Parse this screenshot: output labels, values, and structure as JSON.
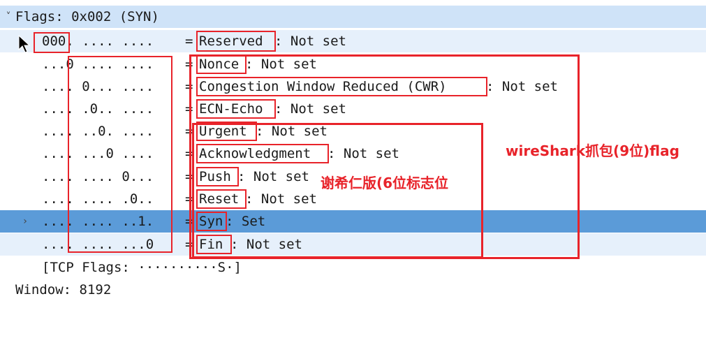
{
  "tree": {
    "flags_header": "Flags: 0x002 (SYN)",
    "rows": [
      {
        "bits": "000. .... ....",
        "name": "Reserved",
        "value": ": Not set"
      },
      {
        "bits": "...0 .... ....",
        "name": "Nonce",
        "value": ": Not set"
      },
      {
        "bits": ".... 0... ....",
        "name": "Congestion Window Reduced (CWR)",
        "value": ": Not set"
      },
      {
        "bits": ".... .0.. ....",
        "name": "ECN-Echo",
        "value": ": Not set"
      },
      {
        "bits": ".... ..0. ....",
        "name": "Urgent",
        "value": ": Not set"
      },
      {
        "bits": ".... ...0 ....",
        "name": "Acknowledgment",
        "value": ": Not set"
      },
      {
        "bits": ".... .... 0...",
        "name": "Push",
        "value": ": Not set"
      },
      {
        "bits": ".... .... .0..",
        "name": "Reset",
        "value": ": Not set"
      },
      {
        "bits": ".... .... ..1.",
        "name": "Syn",
        "value": ": Set"
      },
      {
        "bits": ".... .... ...0",
        "name": "Fin",
        "value": ": Not set"
      }
    ],
    "eq": "=",
    "tcp_flags": "[TCP Flags: ··········S·]",
    "window": "Window: 8192"
  },
  "annotations": {
    "wireshark_label": "wireShark抓包(9位)flag",
    "textbook_label": "谢希仁版(6位标志位"
  },
  "colors": {
    "annotation_red": "#e8232a",
    "selected_row": "#5b9bd8",
    "header_row": "#cfe3f8"
  }
}
